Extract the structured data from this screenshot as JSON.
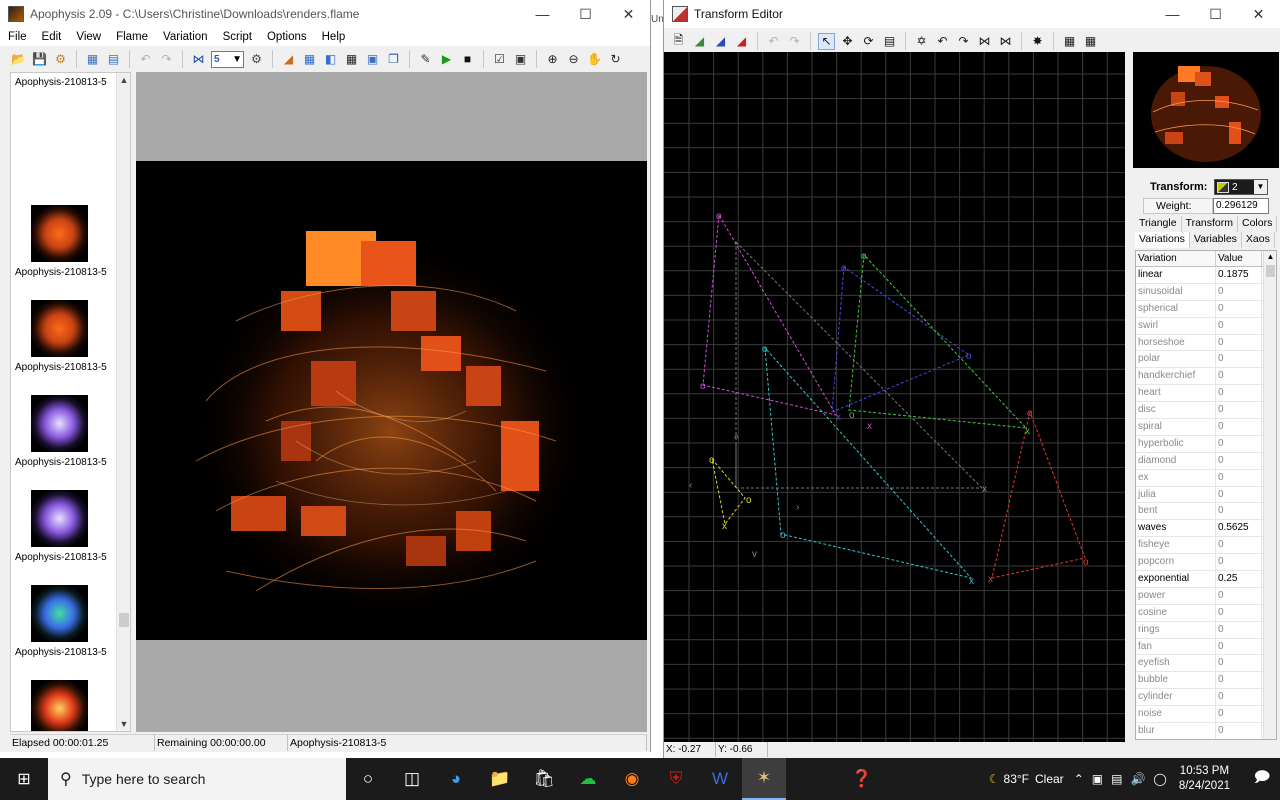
{
  "apophysis": {
    "title": "Apophysis 2.09 - C:\\Users\\Christine\\Downloads\\renders.flame",
    "menu": [
      "File",
      "Edit",
      "View",
      "Flame",
      "Variation",
      "Script",
      "Options",
      "Help"
    ],
    "toolbar_combo_value": "5",
    "thumbnails": [
      {
        "label": "Apophysis-210813-5",
        "palette": "none"
      },
      {
        "label": "Apophysis-210813-5",
        "palette": "orange"
      },
      {
        "label": "Apophysis-210813-5",
        "palette": "orange"
      },
      {
        "label": "Apophysis-210813-5",
        "palette": "violet"
      },
      {
        "label": "Apophysis-210813-5",
        "palette": "violet"
      },
      {
        "label": "Apophysis-210813-5",
        "palette": "rainbow"
      },
      {
        "label": "Apophysis-210813-5",
        "palette": "gold"
      },
      {
        "label": "",
        "palette": "gold"
      }
    ],
    "status": {
      "elapsed": "Elapsed 00:00:01.25",
      "remaining": "Remaining 00:00:00.00",
      "name": "Apophysis-210813-5"
    }
  },
  "transform_editor": {
    "title": "Transform Editor",
    "transform_label": "Transform:",
    "transform_value": "2",
    "weight_label": "Weight:",
    "weight_value": "0.296129",
    "tabs_row1": [
      "Triangle",
      "Transform",
      "Colors"
    ],
    "tabs_row2": [
      "Variations",
      "Variables",
      "Xaos"
    ],
    "table_headers": [
      "Variation",
      "Value"
    ],
    "variations": [
      {
        "name": "linear",
        "value": "0.1875"
      },
      {
        "name": "sinusoidal",
        "value": "0"
      },
      {
        "name": "spherical",
        "value": "0"
      },
      {
        "name": "swirl",
        "value": "0"
      },
      {
        "name": "horseshoe",
        "value": "0"
      },
      {
        "name": "polar",
        "value": "0"
      },
      {
        "name": "handkerchief",
        "value": "0"
      },
      {
        "name": "heart",
        "value": "0"
      },
      {
        "name": "disc",
        "value": "0"
      },
      {
        "name": "spiral",
        "value": "0"
      },
      {
        "name": "hyperbolic",
        "value": "0"
      },
      {
        "name": "diamond",
        "value": "0"
      },
      {
        "name": "ex",
        "value": "0"
      },
      {
        "name": "julia",
        "value": "0"
      },
      {
        "name": "bent",
        "value": "0"
      },
      {
        "name": "waves",
        "value": "0.5625"
      },
      {
        "name": "fisheye",
        "value": "0"
      },
      {
        "name": "popcorn",
        "value": "0"
      },
      {
        "name": "exponential",
        "value": "0.25"
      },
      {
        "name": "power",
        "value": "0"
      },
      {
        "name": "cosine",
        "value": "0"
      },
      {
        "name": "rings",
        "value": "0"
      },
      {
        "name": "fan",
        "value": "0"
      },
      {
        "name": "eyefish",
        "value": "0"
      },
      {
        "name": "bubble",
        "value": "0"
      },
      {
        "name": "cylinder",
        "value": "0"
      },
      {
        "name": "noise",
        "value": "0"
      },
      {
        "name": "blur",
        "value": "0"
      }
    ],
    "coords": {
      "x": "X: -0.27",
      "y": "Y: -0.66"
    },
    "triangle_colors": [
      "#d050d0",
      "#4848e0",
      "#40c840",
      "#30c8c8",
      "#e03a2a",
      "#d8d820",
      "#aaaaaa"
    ],
    "partial_text": "Un"
  },
  "taskbar": {
    "search_placeholder": "Type here to search",
    "weather_temp": "83°F",
    "weather_desc": "Clear",
    "time": "10:53 PM",
    "date": "8/24/2021"
  }
}
